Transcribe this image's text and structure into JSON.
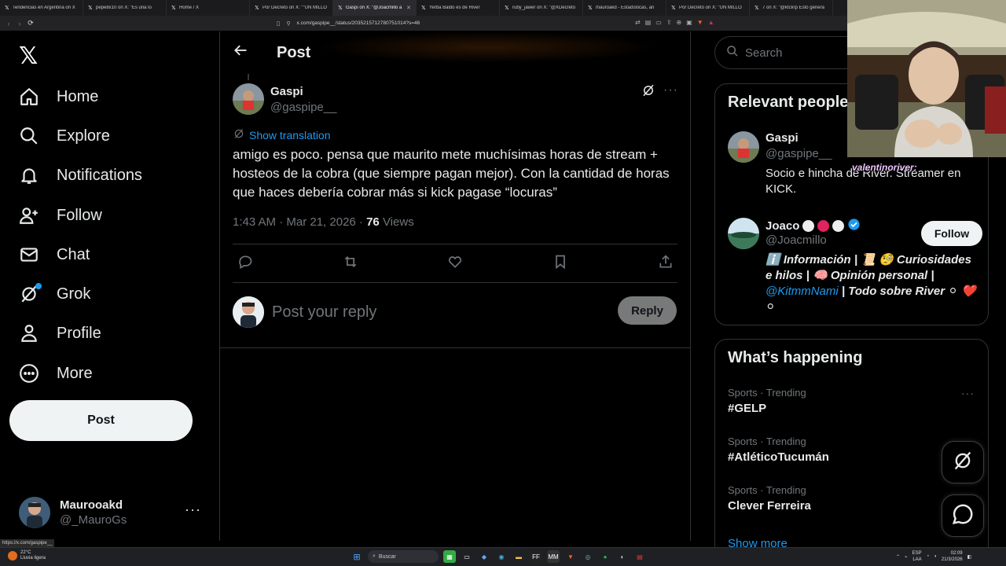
{
  "browser": {
    "tabs": [
      {
        "title": "Tendencias en Argentina on X",
        "active": false
      },
      {
        "title": "pepe8x10 on X: \"Es una lo",
        "active": false
      },
      {
        "title": "Home / X",
        "active": false
      },
      {
        "title": "Por Decreto on X: \"\"UN MILLÓ",
        "active": false
      },
      {
        "title": "Gaspi on X: \"@Joacmillo a",
        "active": true
      },
      {
        "title": "Yerba Baldo es de River",
        "active": false
      },
      {
        "title": "ruby_jawer on X: \"@XDecreto",
        "active": false
      },
      {
        "title": "mauroakd - Estadísticas, an",
        "active": false
      },
      {
        "title": "Por Decreto on X: \"UN MILLÓ",
        "active": false
      },
      {
        "title": "7 on X: \"@ktckrp Esto generá",
        "active": false
      }
    ],
    "url": "x.com/gaspipe__/status/2035215712780751014?s=46",
    "status_url": "https://x.com/gaspipe__"
  },
  "sidebar": {
    "logo": "𝕏",
    "items": [
      {
        "label": "Home",
        "icon": "home-icon"
      },
      {
        "label": "Explore",
        "icon": "search-icon"
      },
      {
        "label": "Notifications",
        "icon": "bell-icon"
      },
      {
        "label": "Follow",
        "icon": "follow-icon"
      },
      {
        "label": "Chat",
        "icon": "mail-icon"
      },
      {
        "label": "Grok",
        "icon": "grok-icon"
      },
      {
        "label": "Profile",
        "icon": "person-icon"
      },
      {
        "label": "More",
        "icon": "more-circle-icon"
      }
    ],
    "post_button": "Post",
    "account": {
      "name": "Maurooakd",
      "handle": "@_MauroGs",
      "more": "···"
    }
  },
  "main": {
    "header_title": "Post",
    "tweet": {
      "author_name": "Gaspi",
      "author_handle": "@gaspipe__",
      "show_translation": "Show translation",
      "text": "amigo es poco. pensa que maurito mete muchísimas horas de stream + hosteos de la cobra (que siempre pagan mejor). Con la cantidad de horas que haces debería cobrar más si kick pagase “locuras”",
      "timestamp": "1:43 AM · Mar 21, 2026 · ",
      "views_count": "76",
      "views_label": " Views",
      "more": "···"
    },
    "reply": {
      "placeholder": "Post your reply",
      "button": "Reply"
    }
  },
  "right": {
    "search_placeholder": "Search",
    "relevant_people": {
      "title": "Relevant people",
      "people": [
        {
          "name": "Gaspi",
          "handle": "@gaspipe__",
          "bio": "Socio e hincha de River. Streamer en KICK."
        },
        {
          "name": "Joaco",
          "handle": "@Joacmillo",
          "follow": "Follow",
          "bio_part1": "ℹ️ Información | 📜 🧐 Curiosidades e hilos | 🧠 Opinión personal | ",
          "bio_link": "@KitmmNami",
          "bio_part2": " | Todo sobre River ⚪ ❤️ ⚪"
        }
      ]
    },
    "whats_happening": {
      "title": "What’s happening",
      "trends": [
        {
          "category": "Sports · Trending",
          "tag": "#GELP"
        },
        {
          "category": "Sports · Trending",
          "tag": "#AtléticoTucumán"
        },
        {
          "category": "Sports · Trending",
          "tag": "Clever Ferreira"
        }
      ],
      "show_more": "Show more"
    }
  },
  "webcam": {
    "chat_label": "valentinoriver:"
  },
  "taskbar": {
    "weather_temp": "22°C",
    "weather_desc": "Lluvia ligera",
    "search": "Buscar",
    "lang": "ESP",
    "lang2": "LAA",
    "time": "02:09",
    "date": "21/3/2026"
  },
  "colors": {
    "accent": "#1d9bf0",
    "background": "#000000",
    "border": "#2f3336",
    "muted": "#71767b"
  }
}
